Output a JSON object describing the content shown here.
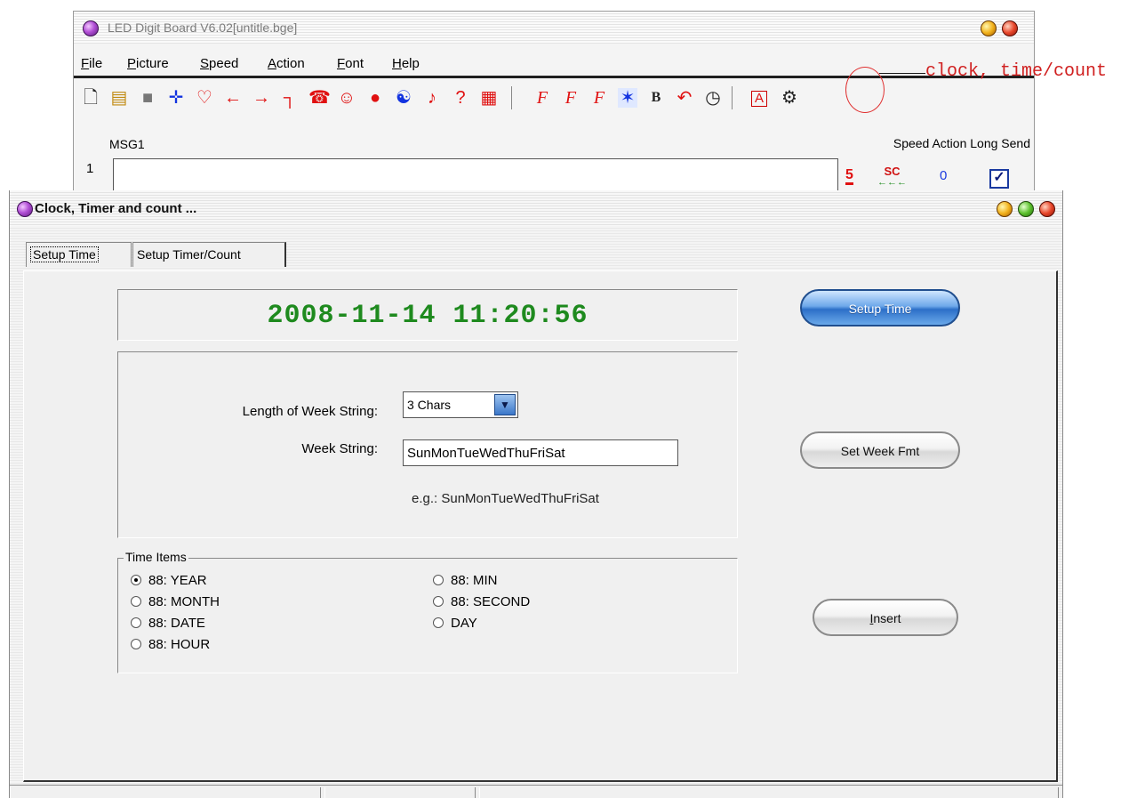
{
  "main_window": {
    "title": "LED Digit Board V6.02[untitle.bge]",
    "menu": [
      "File",
      "Picture",
      "Speed",
      "Action",
      "Font",
      "Help"
    ],
    "toolbar_icons": [
      "new-file-icon",
      "open-folder-icon",
      "save-icon",
      "move-icon",
      "heart-icon",
      "arrow-left-icon",
      "arrow-right-icon",
      "snake-icon",
      "phone-icon",
      "smiley-icon",
      "stop-dot-icon",
      "yin-yang-icon",
      "music-note-icon",
      "question-icon",
      "pattern-icon",
      "font-icon",
      "font-bold-icon",
      "font-size-icon",
      "flash-icon",
      "bold-icon",
      "undo-icon",
      "clock-icon",
      "text-a-icon",
      "settings-icon"
    ],
    "msg_column": "MSG1",
    "columns": "Speed Action Long Send",
    "row_number": "1",
    "row": {
      "speed": "5",
      "action": "SC",
      "action_arrows": "←←←",
      "long": "0",
      "send_checked": true
    }
  },
  "annotation": {
    "text": "clock, time/count"
  },
  "dialog": {
    "title": "Clock, Timer and count ...",
    "tabs": [
      {
        "label": "Setup Time",
        "active": true
      },
      {
        "label": "Setup Timer/Count",
        "active": false
      }
    ],
    "datetime": "2008-11-14 11:20:56",
    "length_label": "Length of Week String:",
    "length_value": "3 Chars",
    "week_label": "Week String:",
    "week_value": "SunMonTueWedThuFriSat",
    "example": "e.g.:  SunMonTueWedThuFriSat",
    "time_items_legend": "Time  Items",
    "time_items": [
      {
        "label": "88: YEAR",
        "checked": true
      },
      {
        "label": "88: MONTH",
        "checked": false
      },
      {
        "label": "88: DATE",
        "checked": false
      },
      {
        "label": "88: HOUR",
        "checked": false
      },
      {
        "label": "88: MIN",
        "checked": false
      },
      {
        "label": "88: SECOND",
        "checked": false
      },
      {
        "label": "DAY",
        "checked": false
      }
    ],
    "buttons": {
      "setup_time": "Setup Time",
      "set_week_fmt": "Set Week Fmt",
      "insert_mnemonic": "I",
      "insert_rest": "nsert"
    }
  },
  "colors": {
    "datetime_green": "#1e8a1e",
    "annotation_red": "#d02020",
    "accent_blue": "#2c6fc8"
  }
}
